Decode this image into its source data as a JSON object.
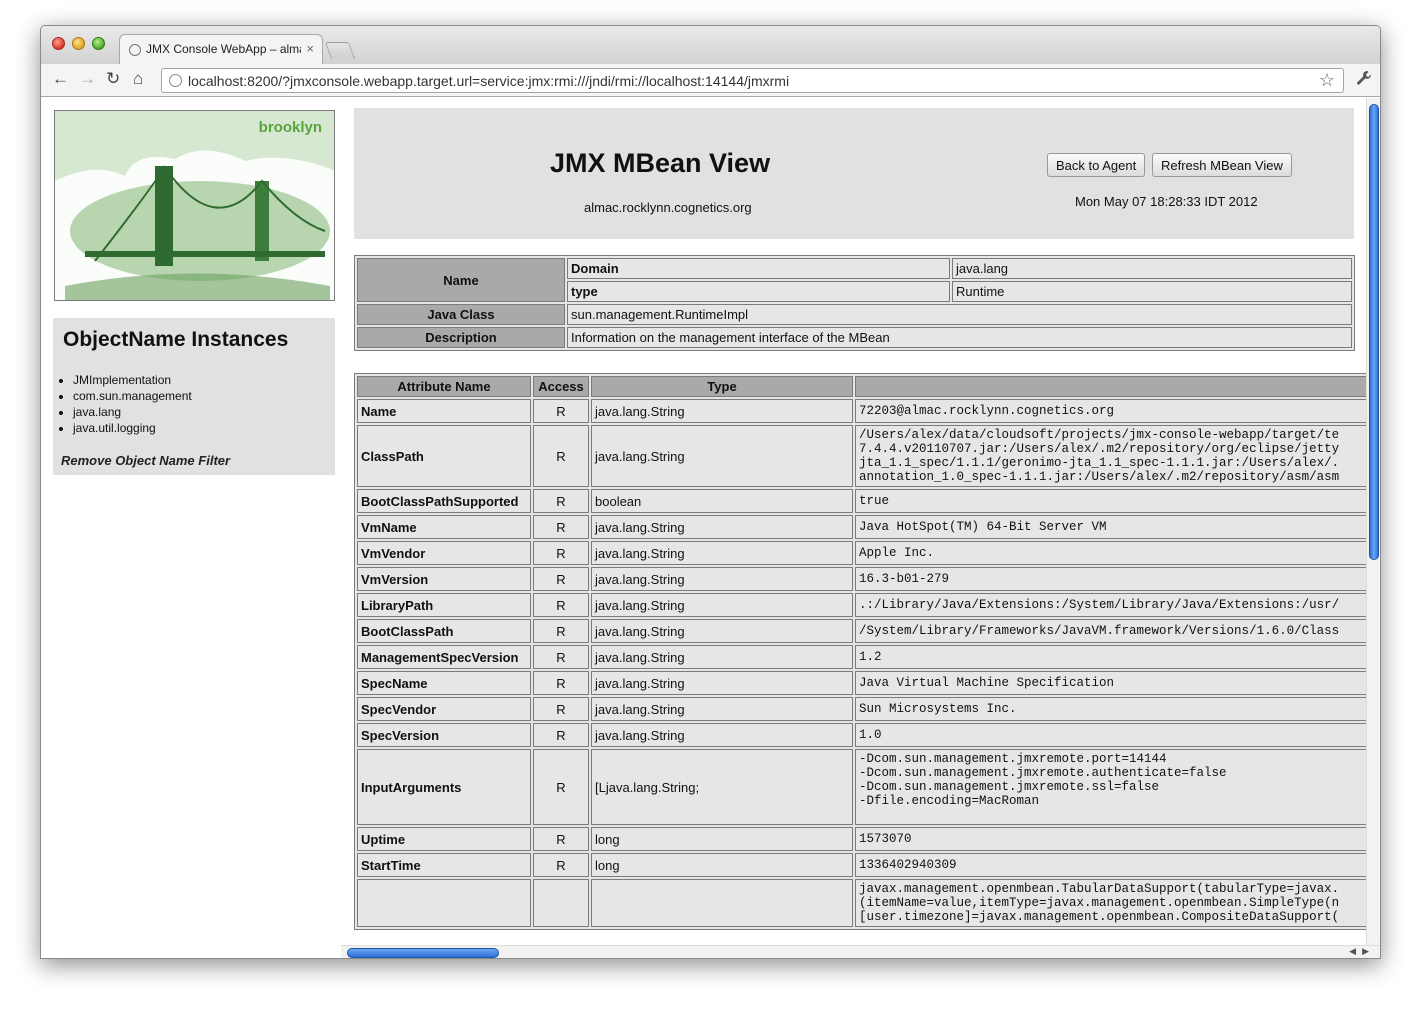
{
  "browser": {
    "tab_title": "JMX Console WebApp – alma",
    "tab_close": "×",
    "url": "localhost:8200/?jmxconsole.webapp.target.url=service:jmx:rmi:///jndi/rmi://localhost:14144/jmxrmi",
    "nav": {
      "back": "←",
      "forward": "→",
      "reload": "↻",
      "home": "⌂"
    },
    "star": "☆",
    "wrench": "🔧"
  },
  "sidebar": {
    "logo_text": "brooklyn",
    "objname_title": "ObjectName Instances",
    "objname_items": [
      "JMImplementation",
      "com.sun.management",
      "java.lang",
      "java.util.logging"
    ],
    "remove_filter": "Remove Object Name Filter"
  },
  "header": {
    "title": "JMX MBean View",
    "host": "almac.rocklynn.cognetics.org",
    "back_button": "Back to Agent",
    "refresh_button": "Refresh MBean View",
    "timestamp": "Mon May 07 18:28:33 IDT 2012"
  },
  "info": {
    "name_label": "Name",
    "domain_label": "Domain",
    "domain_value": "java.lang",
    "type_label": "type",
    "type_value": "Runtime",
    "java_class_label": "Java Class",
    "java_class_value": "sun.management.RuntimeImpl",
    "description_label": "Description",
    "description_value": "Information on the management interface of the MBean"
  },
  "attributes": {
    "headers": {
      "name": "Attribute Name",
      "access": "Access",
      "type": "Type",
      "value": ""
    },
    "rows": [
      {
        "name": "Name",
        "access": "R",
        "type": "java.lang.String",
        "value": "72203@almac.rocklynn.cognetics.org"
      },
      {
        "name": "ClassPath",
        "access": "R",
        "type": "java.lang.String",
        "value": "/Users/alex/data/cloudsoft/projects/jmx-console-webapp/target/te\n7.4.4.v20110707.jar:/Users/alex/.m2/repository/org/eclipse/jetty\njta_1.1_spec/1.1.1/geronimo-jta_1.1_spec-1.1.1.jar:/Users/alex/.\nannotation_1.0_spec-1.1.1.jar:/Users/alex/.m2/repository/asm/asm"
      },
      {
        "name": "BootClassPathSupported",
        "access": "R",
        "type": "boolean",
        "value": "true"
      },
      {
        "name": "VmName",
        "access": "R",
        "type": "java.lang.String",
        "value": "Java HotSpot(TM) 64-Bit Server VM"
      },
      {
        "name": "VmVendor",
        "access": "R",
        "type": "java.lang.String",
        "value": "Apple Inc."
      },
      {
        "name": "VmVersion",
        "access": "R",
        "type": "java.lang.String",
        "value": "16.3-b01-279"
      },
      {
        "name": "LibraryPath",
        "access": "R",
        "type": "java.lang.String",
        "value": ".:/Library/Java/Extensions:/System/Library/Java/Extensions:/usr/"
      },
      {
        "name": "BootClassPath",
        "access": "R",
        "type": "java.lang.String",
        "value": "/System/Library/Frameworks/JavaVM.framework/Versions/1.6.0/Class"
      },
      {
        "name": "ManagementSpecVersion",
        "access": "R",
        "type": "java.lang.String",
        "value": "1.2"
      },
      {
        "name": "SpecName",
        "access": "R",
        "type": "java.lang.String",
        "value": "Java Virtual Machine Specification"
      },
      {
        "name": "SpecVendor",
        "access": "R",
        "type": "java.lang.String",
        "value": "Sun Microsystems Inc."
      },
      {
        "name": "SpecVersion",
        "access": "R",
        "type": "java.lang.String",
        "value": "1.0"
      },
      {
        "name": "InputArguments",
        "access": "R",
        "type": "[Ljava.lang.String;",
        "value": "-Dcom.sun.management.jmxremote.port=14144\n-Dcom.sun.management.jmxremote.authenticate=false\n-Dcom.sun.management.jmxremote.ssl=false\n-Dfile.encoding=MacRoman\n "
      },
      {
        "name": "Uptime",
        "access": "R",
        "type": "long",
        "value": "1573070"
      },
      {
        "name": "StartTime",
        "access": "R",
        "type": "long",
        "value": "1336402940309"
      },
      {
        "name": "",
        "access": "",
        "type": "",
        "value": "javax.management.openmbean.TabularDataSupport(tabularType=javax.\n(itemName=value,itemType=javax.management.openmbean.SimpleType(n\n[user.timezone]=javax.management.openmbean.CompositeDataSupport("
      }
    ]
  }
}
